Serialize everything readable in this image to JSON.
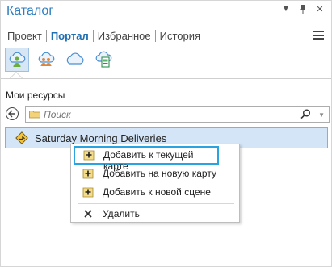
{
  "pane": {
    "title": "Каталог"
  },
  "tabs": [
    {
      "label": "Проект"
    },
    {
      "label": "Портал"
    },
    {
      "label": "Избранное"
    },
    {
      "label": "История"
    }
  ],
  "section": {
    "title": "Мои ресурсы"
  },
  "search": {
    "placeholder": "Поиск"
  },
  "item": {
    "label": "Saturday Morning Deliveries"
  },
  "menu": [
    {
      "label": "Добавить к текущей карте"
    },
    {
      "label": "Добавить на новую карту"
    },
    {
      "label": "Добавить к новой сцене"
    },
    {
      "label": "Удалить"
    }
  ],
  "colors": {
    "accent": "#2e7fbf",
    "selection": "#d3e5f6",
    "highlight_border": "#2aa3e0"
  }
}
